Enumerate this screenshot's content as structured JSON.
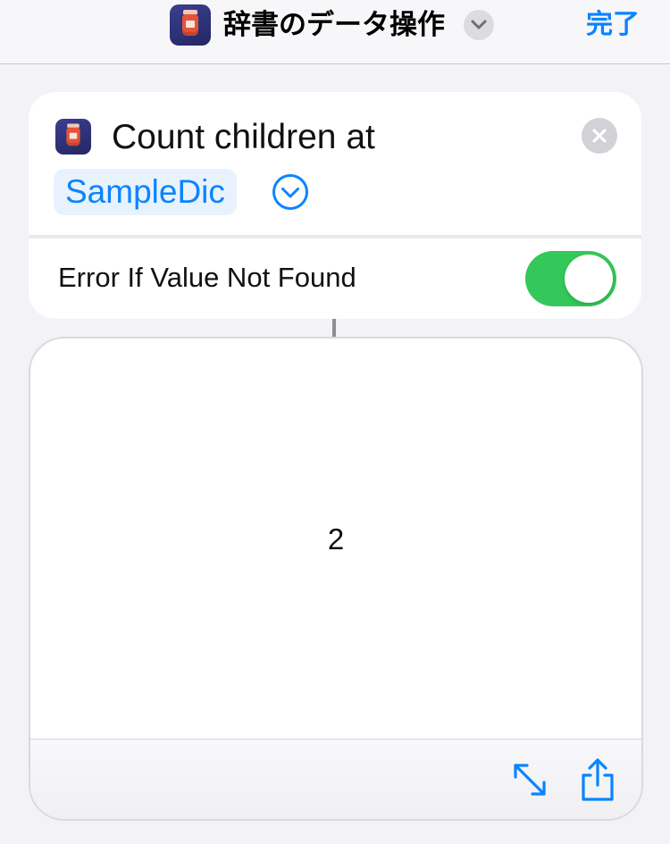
{
  "nav": {
    "title": "辞書のデータ操作",
    "done_label": "完了",
    "app_icon": "jar-icon",
    "chevron_icon": "chevron-down-icon"
  },
  "action": {
    "title": "Count children at",
    "variable": "SampleDic",
    "parameter_label": "Error If Value Not Found",
    "toggle_on": true,
    "icons": {
      "app": "jar-icon",
      "close": "close-icon",
      "expand": "chevron-down-circle-icon"
    }
  },
  "result": {
    "value": "2",
    "icons": {
      "fullscreen": "expand-arrows-icon",
      "share": "share-icon"
    }
  },
  "colors": {
    "accent": "#0a84ff",
    "toggle_on": "#34c759",
    "background": "#f2f2f7",
    "app_icon": "#2e3277"
  }
}
